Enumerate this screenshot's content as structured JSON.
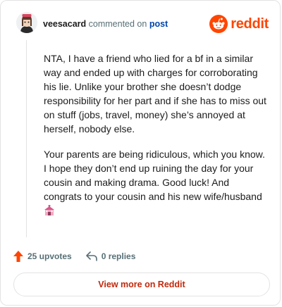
{
  "header": {
    "username": "veesacard",
    "verb": "commented on",
    "post_link": "post",
    "logo_text": "reddit"
  },
  "comment": {
    "paragraphs": [
      "NTA, I have a friend who lied for a bf in a similar way and ended up with charges for corroborating his lie. Unlike your brother she doesn’t dodge responsibility for her part and if she has to miss out on stuff (jobs, travel, money) she’s annoyed at herself, nobody else.",
      "Your parents are being ridiculous, which you know. I hope they don’t end up ruining the day for your cousin and making drama. Good luck! And congrats to your cousin and his new wife/husband"
    ],
    "emoji_icon": "wedding-chapel-icon"
  },
  "actions": {
    "upvotes_label": "25 upvotes",
    "replies_label": "0 replies",
    "upvote_icon": "upvote-arrow-icon",
    "reply_icon": "reply-arrow-icon"
  },
  "footer": {
    "view_more_label": "View more on Reddit"
  },
  "colors": {
    "brand": "#ff4500",
    "link": "#0045ac",
    "meta": "#576f76",
    "view_more": "#c2280b"
  }
}
